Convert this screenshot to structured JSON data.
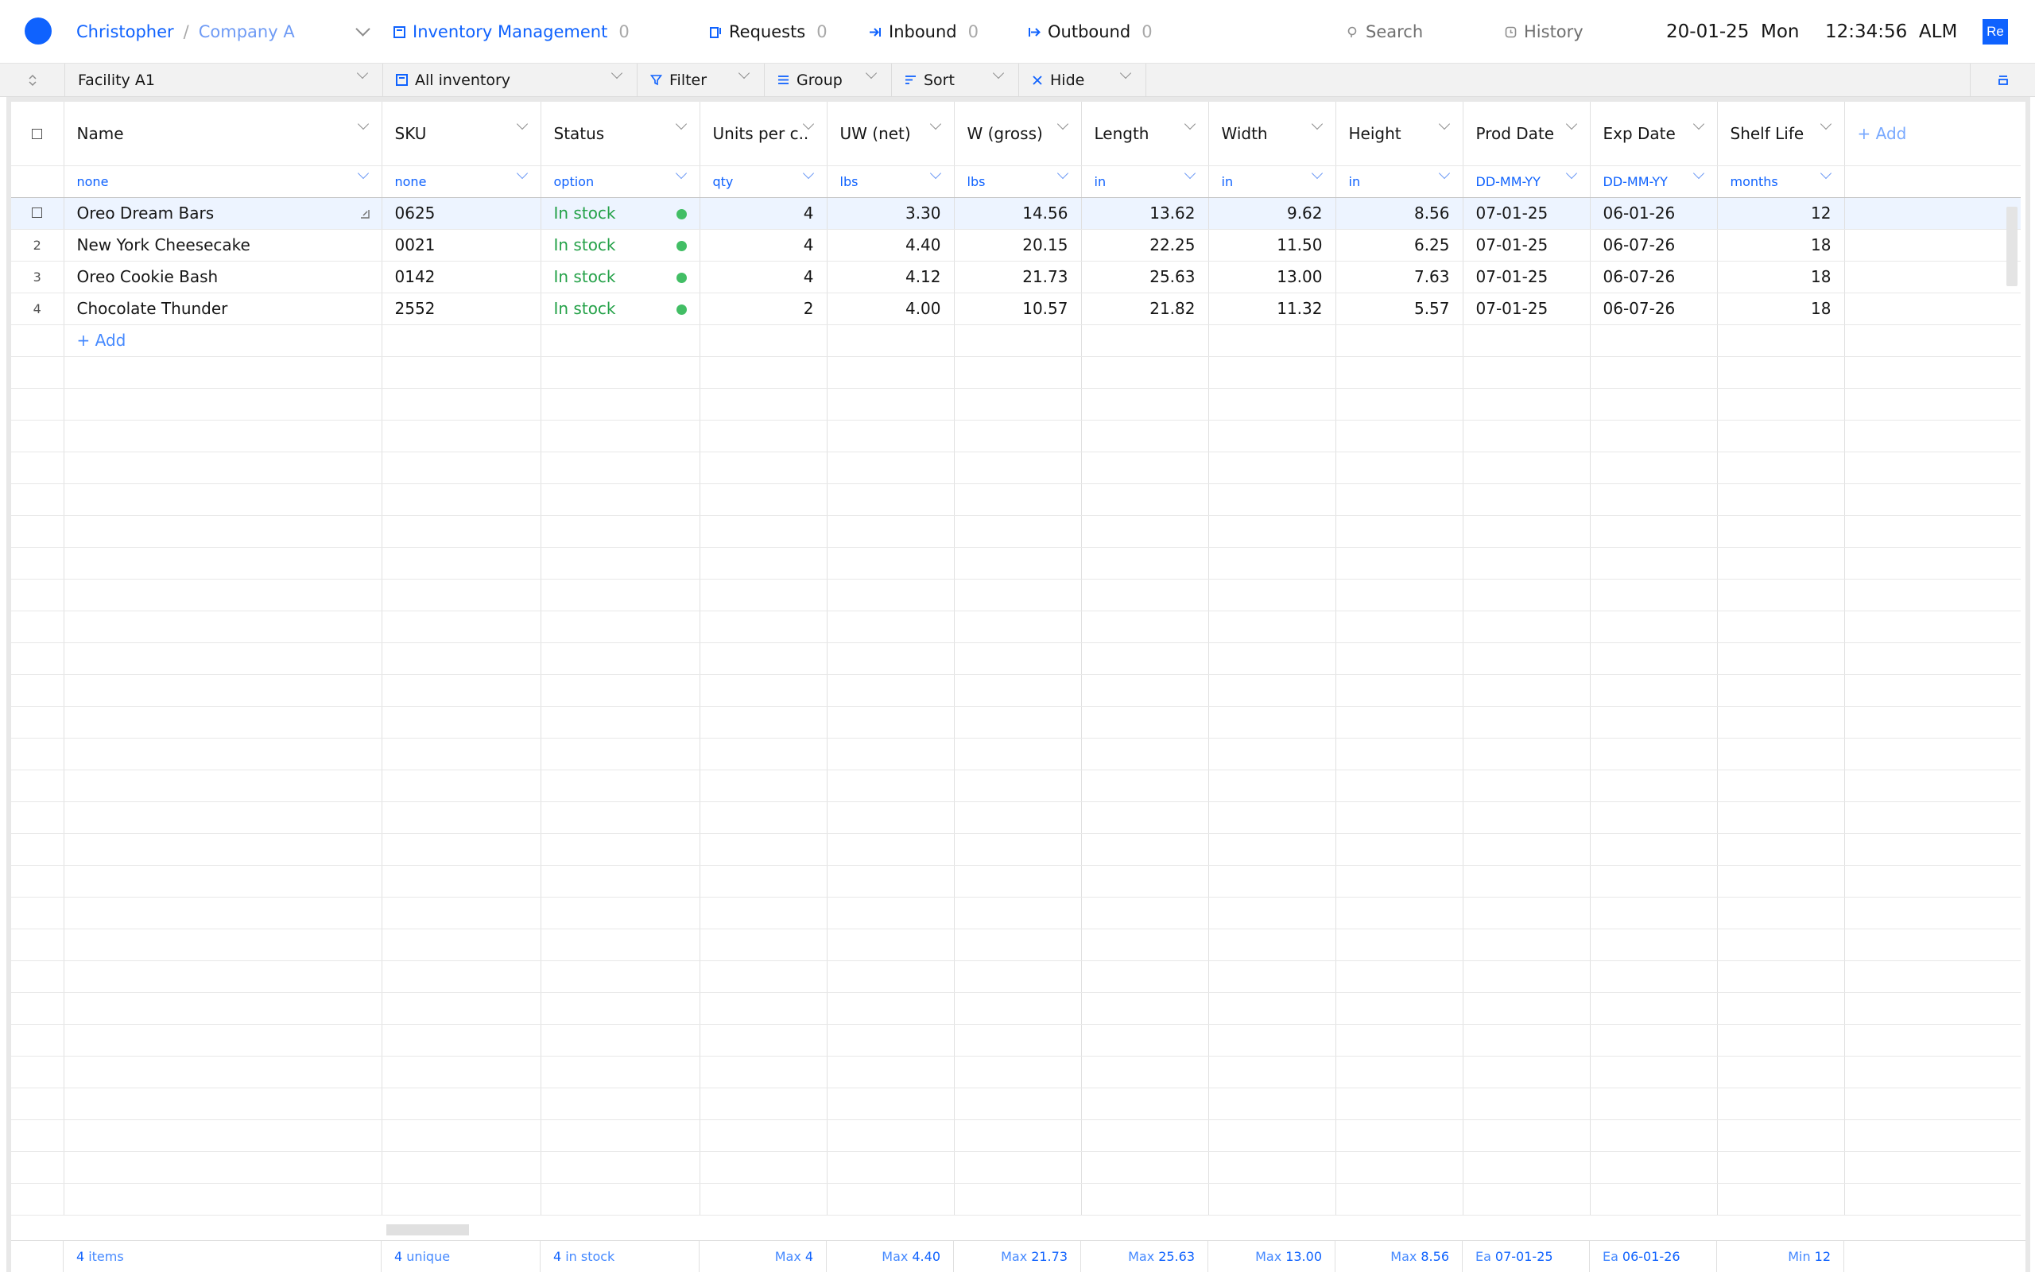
{
  "topbar": {
    "user": "Christopher",
    "separator": "/",
    "company": "Company A",
    "app": {
      "label": "Inventory Management",
      "count": "0"
    },
    "requests": {
      "label": "Requests",
      "count": "0"
    },
    "inbound": {
      "label": "Inbound",
      "count": "0"
    },
    "outbound": {
      "label": "Outbound",
      "count": "0"
    },
    "search": "Search",
    "history": "History",
    "date": "20-01-25  Mon",
    "time": "12:34:56  ALM",
    "avatar": "Re"
  },
  "toolbar": {
    "facility": "Facility A1",
    "view": "All inventory",
    "filter": "Filter",
    "group": "Group",
    "sort": "Sort",
    "hide": "Hide"
  },
  "columns": [
    {
      "label": "Name",
      "unit": "none"
    },
    {
      "label": "SKU",
      "unit": "none"
    },
    {
      "label": "Status",
      "unit": "option"
    },
    {
      "label": "Units per c..",
      "unit": "qty"
    },
    {
      "label": "UW (net)",
      "unit": "lbs"
    },
    {
      "label": "W (gross)",
      "unit": "lbs"
    },
    {
      "label": "Length",
      "unit": "in"
    },
    {
      "label": "Width",
      "unit": "in"
    },
    {
      "label": "Height",
      "unit": "in"
    },
    {
      "label": "Prod Date",
      "unit": "DD-MM-YY"
    },
    {
      "label": "Exp Date",
      "unit": "DD-MM-YY"
    },
    {
      "label": "Shelf Life",
      "unit": "months"
    }
  ],
  "add_column": "+ Add",
  "rows": [
    {
      "idx": "",
      "name": "Oreo Dream Bars",
      "sku": "0625",
      "status": "In stock",
      "units": "4",
      "uw": "3.30",
      "wg": "14.56",
      "length": "13.62",
      "width": "9.62",
      "height": "8.56",
      "prod": "07-01-25",
      "exp": "06-01-26",
      "shelf": "12"
    },
    {
      "idx": "2",
      "name": "New York Cheesecake",
      "sku": "0021",
      "status": "In stock",
      "units": "4",
      "uw": "4.40",
      "wg": "20.15",
      "length": "22.25",
      "width": "11.50",
      "height": "6.25",
      "prod": "07-01-25",
      "exp": "06-07-26",
      "shelf": "18"
    },
    {
      "idx": "3",
      "name": "Oreo Cookie Bash",
      "sku": "0142",
      "status": "In stock",
      "units": "4",
      "uw": "4.12",
      "wg": "21.73",
      "length": "25.63",
      "width": "13.00",
      "height": "7.63",
      "prod": "07-01-25",
      "exp": "06-07-26",
      "shelf": "18"
    },
    {
      "idx": "4",
      "name": "Chocolate Thunder",
      "sku": "2552",
      "status": "In stock",
      "units": "2",
      "uw": "4.00",
      "wg": "10.57",
      "length": "21.82",
      "width": "11.32",
      "height": "5.57",
      "prod": "07-01-25",
      "exp": "06-07-26",
      "shelf": "18"
    }
  ],
  "add_row": "+ Add",
  "footer": {
    "items": {
      "value": "4",
      "label": "items"
    },
    "unique": {
      "value": "4",
      "label": "unique"
    },
    "instock": {
      "value": "4",
      "label": "in stock"
    },
    "units": {
      "label": "Max",
      "value": "4"
    },
    "uw": {
      "label": "Max",
      "value": "4.40"
    },
    "wg": {
      "label": "Max",
      "value": "21.73"
    },
    "length": {
      "label": "Max",
      "value": "25.63"
    },
    "width": {
      "label": "Max",
      "value": "13.00"
    },
    "height": {
      "label": "Max",
      "value": "8.56"
    },
    "prod": {
      "label": "Ea",
      "value": "07-01-25"
    },
    "exp": {
      "label": "Ea",
      "value": "06-01-26"
    },
    "shelf": {
      "label": "Min",
      "value": "12"
    }
  },
  "colors": {
    "accent": "#0f62fe",
    "status_ok": "#24a148",
    "status_dot": "#42be65",
    "selected_row": "#edf4ff"
  }
}
